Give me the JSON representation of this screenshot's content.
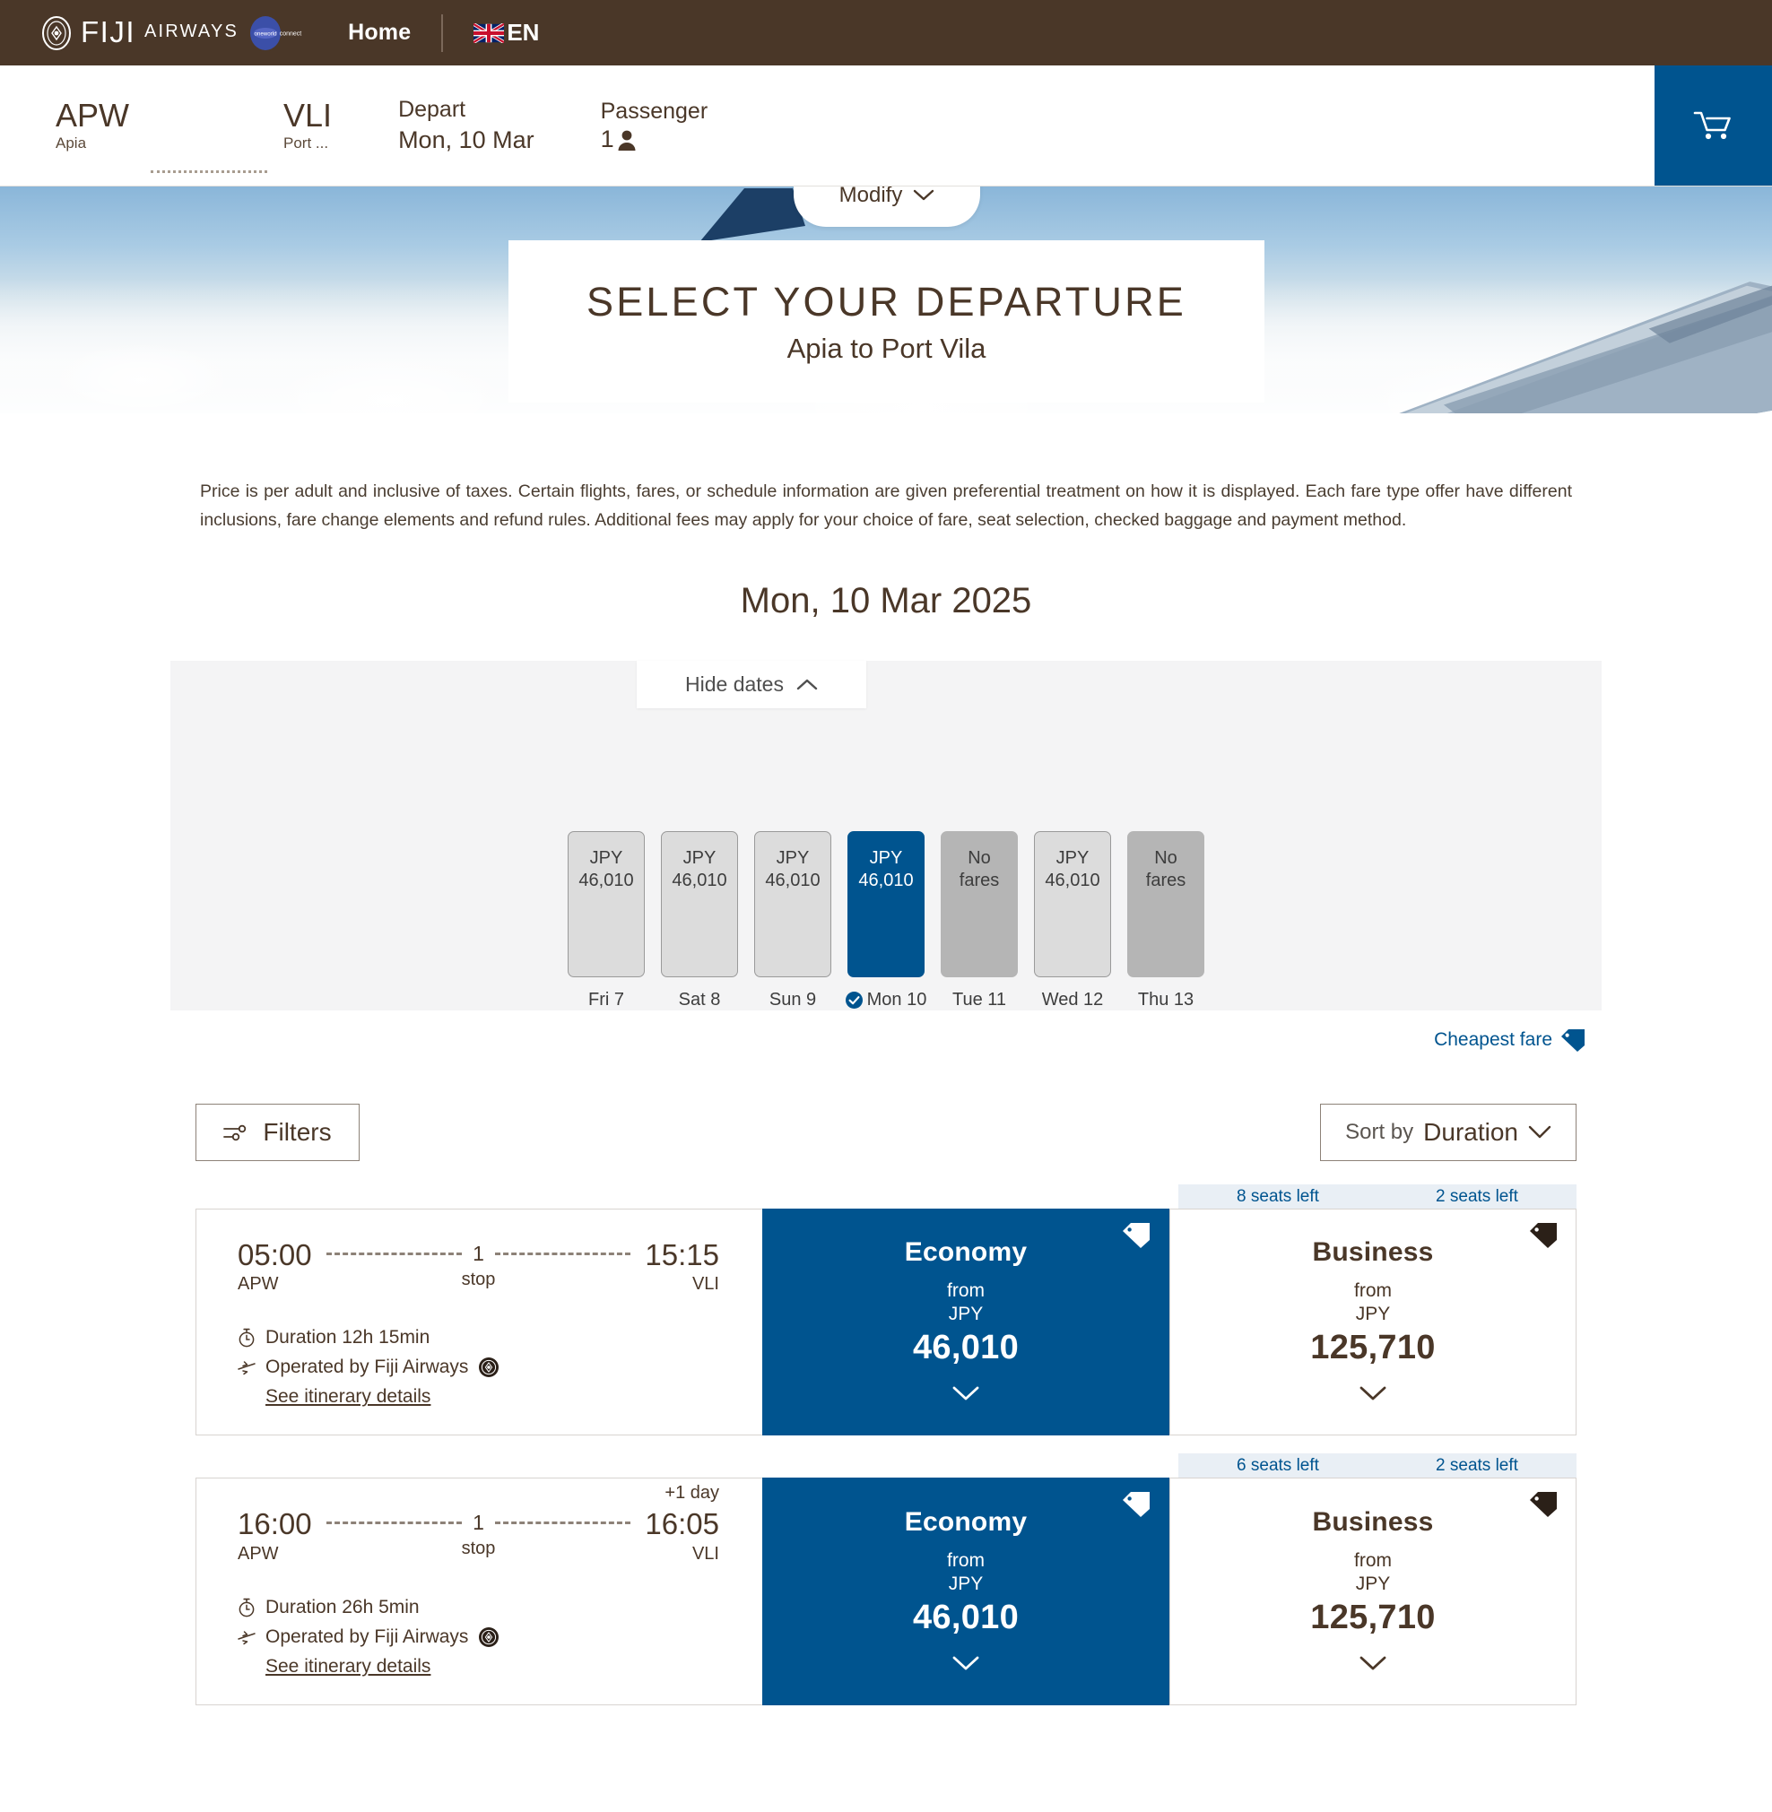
{
  "nav": {
    "brand_fiji": "FIJI",
    "brand_airways": "AIRWAYS",
    "oneworld": "oneworld connect",
    "home": "Home",
    "language": "EN",
    "language_flag": "uk-flag-icon"
  },
  "search_summary": {
    "origin_code": "APW",
    "origin_city": "Apia",
    "destination_code": "VLI",
    "destination_city": "Port ...",
    "depart_label": "Depart",
    "depart_value": "Mon, 10 Mar",
    "passenger_label": "Passenger",
    "passenger_count": "1",
    "cart_icon": "shopping-cart-icon",
    "modify_label": "Modify"
  },
  "hero": {
    "title": "SELECT YOUR DEPARTURE",
    "subtitle": "Apia to Port Vila"
  },
  "disclaimer": "Price is per adult and inclusive of taxes. Certain flights, fares, or schedule information are given preferential treatment on how it is displayed. Each fare type offer have different inclusions, fare change elements and refund rules. Additional fees may apply for your choice of fare, seat selection, checked baggage and payment method.",
  "date_heading": "Mon, 10 Mar 2025",
  "carousel": {
    "hide_dates_label": "Hide dates",
    "currency": "JPY",
    "no_fares_label": "No fares",
    "tiles": [
      {
        "currency": "JPY",
        "price": "46,010",
        "label": "Fri 7",
        "state": "avail",
        "selected": false
      },
      {
        "currency": "JPY",
        "price": "46,010",
        "label": "Sat 8",
        "state": "avail",
        "selected": false
      },
      {
        "currency": "JPY",
        "price": "46,010",
        "label": "Sun 9",
        "state": "avail",
        "selected": false
      },
      {
        "currency": "JPY",
        "price": "46,010",
        "label": "Mon 10",
        "state": "selected",
        "selected": true
      },
      {
        "currency": "",
        "price": "No fares",
        "label": "Tue 11",
        "state": "nofare",
        "selected": false
      },
      {
        "currency": "JPY",
        "price": "46,010",
        "label": "Wed 12",
        "state": "avail",
        "selected": false
      },
      {
        "currency": "",
        "price": "No fares",
        "label": "Thu 13",
        "state": "nofare",
        "selected": false
      }
    ]
  },
  "cheapest": {
    "label": "Cheapest fare",
    "icon": "price-tag-icon",
    "color": "#00548f"
  },
  "controls": {
    "filters_label": "Filters",
    "sort_prefix": "Sort by",
    "sort_value": "Duration"
  },
  "flights": [
    {
      "depart_time": "05:00",
      "depart_port": "APW",
      "arrive_time": "15:15",
      "arrive_port": "VLI",
      "plus_day": "",
      "stops_num": "1",
      "stops_text": "stop",
      "duration": "Duration 12h 15min",
      "operated_by": "Operated by Fiji Airways",
      "details_link": "See itinerary details",
      "fares": [
        {
          "cabin": "Economy",
          "from": "from",
          "currency": "JPY",
          "amount": "46,010",
          "seats_left": "8 seats left",
          "highlighted": true
        },
        {
          "cabin": "Business",
          "from": "from",
          "currency": "JPY",
          "amount": "125,710",
          "seats_left": "2 seats left",
          "highlighted": false
        }
      ]
    },
    {
      "depart_time": "16:00",
      "depart_port": "APW",
      "arrive_time": "16:05",
      "arrive_port": "VLI",
      "plus_day": "+1 day",
      "stops_num": "1",
      "stops_text": "stop",
      "duration": "Duration 26h 5min",
      "operated_by": "Operated by Fiji Airways",
      "details_link": "See itinerary details",
      "fares": [
        {
          "cabin": "Economy",
          "from": "from",
          "currency": "JPY",
          "amount": "46,010",
          "seats_left": "6 seats left",
          "highlighted": true
        },
        {
          "cabin": "Business",
          "from": "from",
          "currency": "JPY",
          "amount": "125,710",
          "seats_left": "2 seats left",
          "highlighted": false
        }
      ]
    }
  ],
  "colors": {
    "brand_brown": "#4a3728",
    "brand_blue": "#00548f",
    "tile_grey": "#dcdcdc"
  }
}
